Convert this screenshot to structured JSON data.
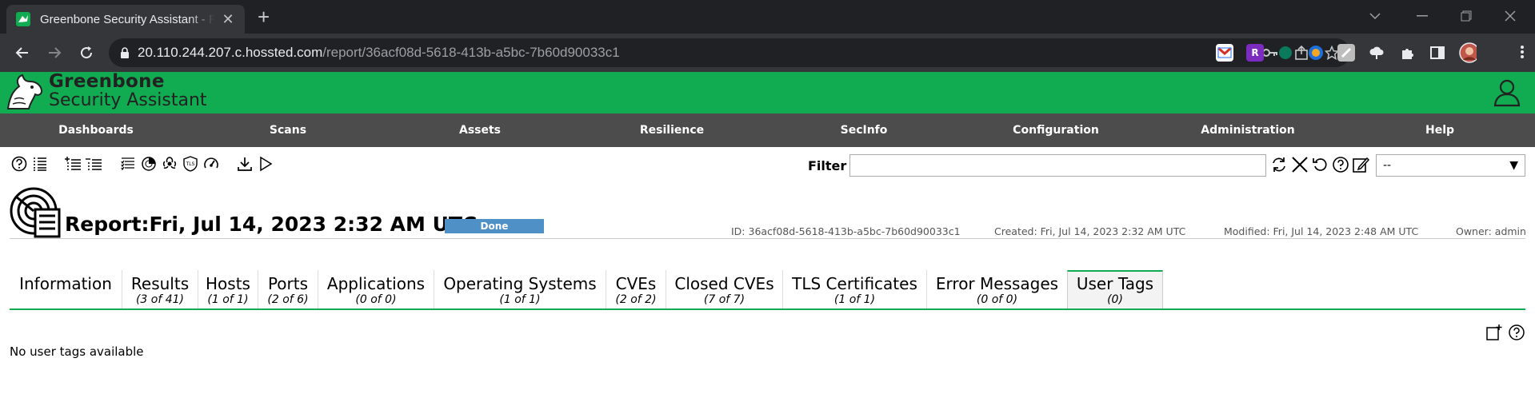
{
  "browser": {
    "tab_title": "Greenbone Security Assistant - Report",
    "url_host": "20.110.244.207.c.hossted.com",
    "url_path": "/report/36acf08d-5618-413b-a5bc-7b60d90033c1"
  },
  "app": {
    "logo_line1": "Greenbone",
    "logo_line2": "Security Assistant"
  },
  "menu": [
    "Dashboards",
    "Scans",
    "Assets",
    "Resilience",
    "SecInfo",
    "Configuration",
    "Administration",
    "Help"
  ],
  "filter": {
    "label": "Filter",
    "value": "",
    "select_value": "--"
  },
  "report": {
    "title": "Report:Fri, Jul 14, 2023 2:32 AM UTC",
    "status": "Done",
    "id": "ID: 36acf08d-5618-413b-a5bc-7b60d90033c1",
    "created": "Created: Fri, Jul 14, 2023 2:32 AM UTC",
    "modified": "Modified: Fri, Jul 14, 2023 2:48 AM UTC",
    "owner": "Owner: admin"
  },
  "tabs": [
    {
      "label": "Information",
      "count": ""
    },
    {
      "label": "Results",
      "count": "(3 of 41)"
    },
    {
      "label": "Hosts",
      "count": "(1 of 1)"
    },
    {
      "label": "Ports",
      "count": "(2 of 6)"
    },
    {
      "label": "Applications",
      "count": "(0 of 0)"
    },
    {
      "label": "Operating Systems",
      "count": "(1 of 1)"
    },
    {
      "label": "CVEs",
      "count": "(2 of 2)"
    },
    {
      "label": "Closed CVEs",
      "count": "(7 of 7)"
    },
    {
      "label": "TLS Certificates",
      "count": "(1 of 1)"
    },
    {
      "label": "Error Messages",
      "count": "(0 of 0)"
    },
    {
      "label": "User Tags",
      "count": "(0)"
    }
  ],
  "active_tab": "User Tags",
  "content": {
    "empty_message": "No user tags available"
  },
  "colors": {
    "brand_green": "#11ab51",
    "menubar": "#4c4c4c",
    "status_done": "#4f91c7"
  }
}
